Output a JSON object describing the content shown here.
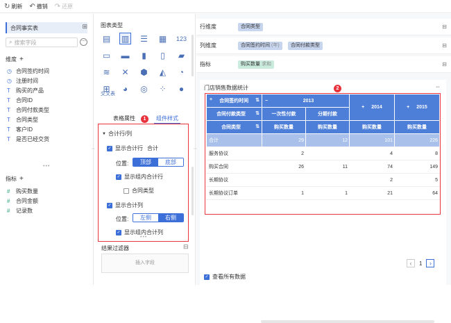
{
  "toolbar": {
    "refresh": "刷新",
    "undo": "撤销",
    "redo": "还原"
  },
  "left": {
    "dataset": "合同事实表",
    "search_placeholder": "搜索字段",
    "dimension_title": "维度",
    "dimensions": [
      {
        "icon": "clock-icon",
        "glyph": "◷",
        "label": "合同签约时间"
      },
      {
        "icon": "clock-icon",
        "glyph": "◷",
        "label": "注册时间"
      },
      {
        "icon": "text-icon",
        "glyph": "T",
        "label": "购买的产品"
      },
      {
        "icon": "text-icon",
        "glyph": "T",
        "label": "合同ID"
      },
      {
        "icon": "text-icon",
        "glyph": "T",
        "label": "合同付款类型"
      },
      {
        "icon": "text-icon",
        "glyph": "T",
        "label": "合同类型"
      },
      {
        "icon": "text-icon",
        "glyph": "T",
        "label": "客户ID"
      },
      {
        "icon": "text-icon",
        "glyph": "T",
        "label": "是否已经交货"
      }
    ],
    "measure_title": "指标",
    "measures": [
      {
        "icon": "hash-icon",
        "glyph": "#",
        "label": "购买数量"
      },
      {
        "icon": "hash-icon",
        "glyph": "#",
        "label": "合同金额"
      },
      {
        "icon": "formula-icon",
        "glyph": "#",
        "label": "记录数"
      }
    ]
  },
  "middle": {
    "chart_type_title": "图表类型",
    "crosstab_label": "交叉表",
    "tab_table_attr": "表格属性",
    "tab_component_style": "组件样式",
    "badge1": "1",
    "subtotal_title": "合计行/列",
    "show_total_row": "显示合计行",
    "total_label": "合计",
    "position_label": "位置:",
    "row_pos_top": "顶部",
    "row_pos_bottom": "底部",
    "show_group_total_row": "显示组内合计行",
    "contract_type": "合同类型",
    "show_total_col": "显示合计列",
    "col_pos_left": "左侧",
    "col_pos_right": "右侧",
    "show_group_total_col": "显示组内合计列",
    "filter_title": "结果过滤器",
    "insert_field": "插入字段"
  },
  "right": {
    "row_dim_label": "行维度",
    "row_dim_pill": "合同类型",
    "col_dim_label": "列维度",
    "col_dim_pill1": "合同签约时间",
    "col_dim_pill1_extra": "(年)",
    "col_dim_pill2": "合同付款类型",
    "measure_label": "指标",
    "measure_pill": "购买数量",
    "measure_pill_extra": "求和",
    "card_title": "门店销售数据统计",
    "badge2": "2",
    "table": {
      "h_sign_time": "合同签约时间",
      "h_pay_type": "合同付款类型",
      "h_contract_type": "合同类型",
      "y2013": "2013",
      "y2014": "2014",
      "y2015": "2015",
      "minus": "−",
      "plus": "+",
      "one_time": "一次性付款",
      "installment": "分期付款",
      "qty": "购买数量",
      "rows": [
        {
          "label": "合计",
          "v1": "29",
          "v2": "12",
          "v3": "101",
          "v4": "226"
        },
        {
          "label": "服务协议",
          "v1": "2",
          "v2": "",
          "v3": "4",
          "v4": "8"
        },
        {
          "label": "购买合同",
          "v1": "26",
          "v2": "11",
          "v3": "74",
          "v4": "149"
        },
        {
          "label": "长期协议",
          "v1": "",
          "v2": "",
          "v3": "2",
          "v4": "5"
        },
        {
          "label": "长期协议订单",
          "v1": "1",
          "v2": "1",
          "v3": "21",
          "v4": "64"
        }
      ]
    },
    "page_num": "1",
    "view_all": "查看所有数据"
  }
}
